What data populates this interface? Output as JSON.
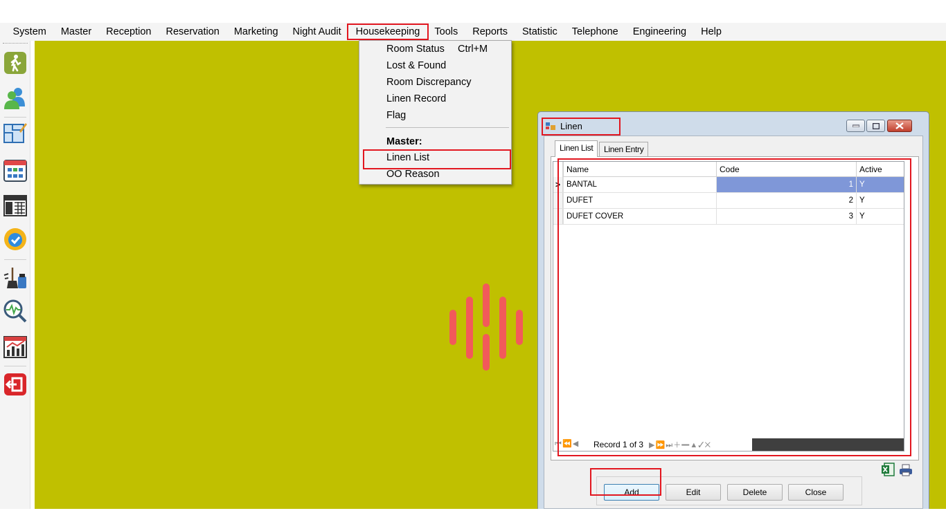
{
  "menubar": {
    "items": [
      "System",
      "Master",
      "Reception",
      "Reservation",
      "Marketing",
      "Night Audit",
      "Housekeeping",
      "Tools",
      "Reports",
      "Statistic",
      "Telephone",
      "Engineering",
      "Help"
    ],
    "active": "Housekeeping"
  },
  "toolbar": {
    "icons": [
      "walking-person-icon",
      "users-icon",
      "floor-plan-icon",
      "room-grid-icon",
      "calendar-2023-icon",
      "available-badge-icon",
      "housekeeping-icon",
      "search-analytics-icon",
      "report-chart-icon",
      "logout-icon"
    ]
  },
  "dropdown": {
    "room_status": "Room Status",
    "room_status_shortcut": "Ctrl+M",
    "lost_found": "Lost & Found",
    "room_discrepancy": "Room Discrepancy",
    "linen_record": "Linen Record",
    "flag": "Flag",
    "master_header": "Master:",
    "linen_list": "Linen List",
    "oo_reason": "OO Reason"
  },
  "window": {
    "title": "Linen",
    "tabs": [
      "Linen List",
      "Linen Entry"
    ],
    "selected_tab": "Linen List",
    "grid": {
      "columns": [
        "Name",
        "Code",
        "Active"
      ],
      "rows": [
        {
          "name": "BANTAL",
          "code": "1",
          "active": "Y"
        },
        {
          "name": "DUFET",
          "code": "2",
          "active": "Y"
        },
        {
          "name": "DUFET COVER",
          "code": "3",
          "active": "Y"
        }
      ],
      "current_row_marker": ">",
      "navigator_text": "Record 1 of 3"
    },
    "buttons": {
      "add": "Add",
      "edit": "Edit",
      "delete": "Delete",
      "close": "Close"
    }
  },
  "colors": {
    "desktop": "#c0c000",
    "highlight": "#e2161f",
    "selected_cell": "#7f97d8",
    "watermark": "#f25a5a"
  }
}
